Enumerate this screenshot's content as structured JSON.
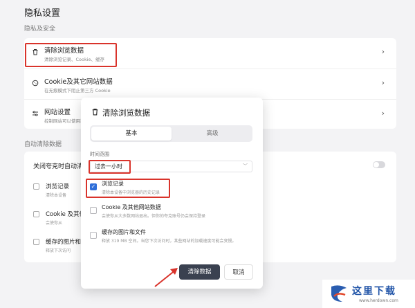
{
  "page": {
    "title": "隐私设置",
    "section_privacy": "隐私及安全",
    "section_auto": "自动清除数据"
  },
  "privacy_rows": [
    {
      "label": "清除浏览数据",
      "sub": "清除浏览记录、Cookie、缓存",
      "icon": "trash-icon"
    },
    {
      "label": "Cookie及其它网站数据",
      "sub": "在无痕模式下阻止第三方 Cookie",
      "icon": "cookie-icon"
    },
    {
      "label": "网站设置",
      "sub": "控制网站可以使用和显示",
      "icon": "sliders-icon"
    }
  ],
  "auto_clear": {
    "header": "关闭夸克时自动清除",
    "toggle_on": false,
    "items": [
      {
        "label": "浏览记录",
        "sub": "清除本设备"
      },
      {
        "label": "Cookie 及其他",
        "sub": "会使你从"
      },
      {
        "label": "缓存的图片和",
        "sub": "释放下次访问"
      }
    ]
  },
  "dialog": {
    "title": "清除浏览数据",
    "tabs": [
      "基本",
      "高级"
    ],
    "active_tab": "基本",
    "range_label": "时间范围",
    "range_value": "过去一小时",
    "options": [
      {
        "label": "浏览记录",
        "sub": "清除本设备中浏览器的历史记录",
        "checked": true
      },
      {
        "label": "Cookie 及其他网站数据",
        "sub": "会使你从大多数网站退出。但你的夸克账号仍会保持登录",
        "checked": false
      },
      {
        "label": "缓存的图片和文件",
        "sub": "释放 319 MB 空间。当您下次访问时，某些网站的加载速度可能会变慢。",
        "checked": false
      }
    ],
    "clear_button": "清除数据",
    "cancel_button": "取消"
  },
  "watermark": {
    "text": "这里下载",
    "url": "www.herdown.com"
  },
  "colors": {
    "highlight": "#d9332b",
    "accent": "#2f6fd9",
    "primary_button": "#3a4150"
  }
}
